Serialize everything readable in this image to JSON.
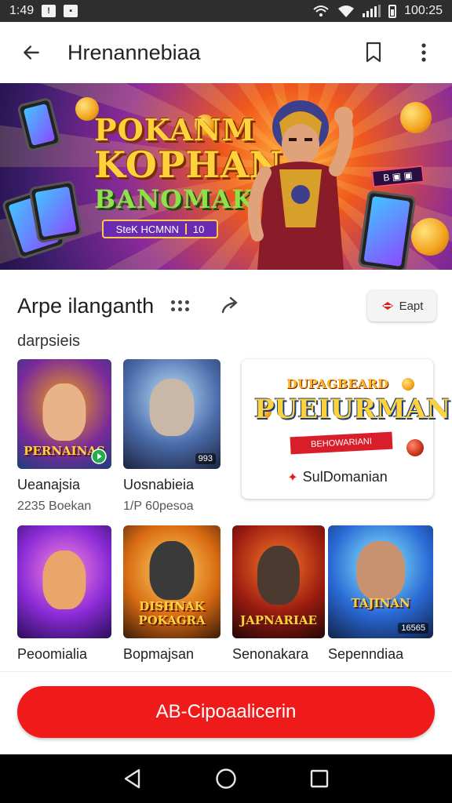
{
  "status_bar": {
    "time": "1:49",
    "clock_right": "100:25",
    "icons": [
      "notification-icon",
      "image-icon",
      "sync-icon",
      "wifi-icon",
      "signal-icon",
      "battery-icon"
    ]
  },
  "app_bar": {
    "title": "Hrenannebiaa",
    "icons": [
      "back-arrow-icon",
      "bookmark-icon",
      "more-vert-icon"
    ]
  },
  "banner": {
    "title_line1": "POKANM",
    "title_line2": "KOPHAN",
    "title_line3": "BANOMAK",
    "chip_label": "SteK HCMNN",
    "chip_suffix": "10"
  },
  "section": {
    "title": "Arpe ilanganth",
    "subtitle": "darpsieis",
    "chip_label": "Eapt"
  },
  "tiles_row1": [
    {
      "name": "Ueanajsia",
      "meta": "2235 Boekan",
      "art_text": "PERNAINAS",
      "colors": [
        "#f6a316",
        "#7a2a9a",
        "#1c3f7a"
      ]
    },
    {
      "name": "Uosnabieia",
      "meta": "1/P 60pesoa",
      "art_text": "",
      "badge": "993",
      "colors": [
        "#bfe3ff",
        "#4a6aa8",
        "#1c2440"
      ]
    }
  ],
  "promo": {
    "line1": "DUPAGBEARD",
    "line2": "PUEIURMAN",
    "ribbon": "BEHOWARIANI",
    "footer": "SulDomanian"
  },
  "tiles_row2": [
    {
      "name": "Peoomialia",
      "art_text": "",
      "colors": [
        "#ff8adf",
        "#8a2bd6",
        "#2a0d5a"
      ]
    },
    {
      "name": "Bopmajsan",
      "art_text": "DISHNAK POKAGRA",
      "colors": [
        "#ffd76a",
        "#d96b12",
        "#3a1a08"
      ]
    },
    {
      "name": "Senonakara",
      "art_text": "JAPNARIAE",
      "colors": [
        "#ff7a2a",
        "#9a1c10",
        "#240606"
      ]
    },
    {
      "name": "Sepenndiaa",
      "art_text": "TAJINAN",
      "badge": "16565",
      "colors": [
        "#8ff3ff",
        "#2a6ad6",
        "#10224a"
      ]
    }
  ],
  "cta": {
    "label": "AB-Cipoaalicerin"
  },
  "nav_bar": {
    "icons": [
      "back-triangle-icon",
      "home-circle-icon",
      "recents-square-icon"
    ]
  }
}
